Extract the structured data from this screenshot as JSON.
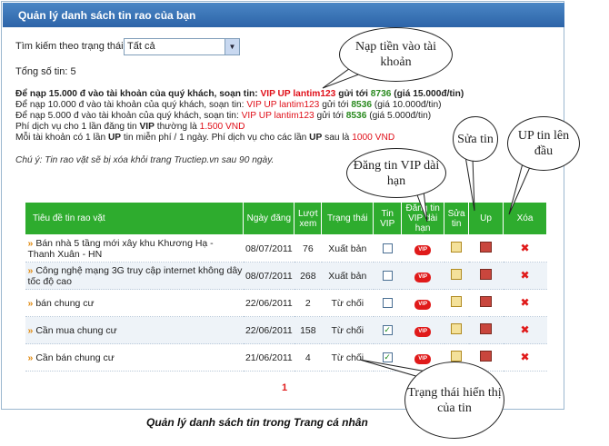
{
  "header": {
    "title": "Quản lý danh sách tin rao của bạn"
  },
  "filter": {
    "label": "Tìm kiếm theo trạng thái:",
    "selected": "Tất cả"
  },
  "total": "Tổng số tin: 5",
  "info": {
    "line1": {
      "a": "Để nạp 15.000 đ vào tài khoản của quý khách, soạn tin: ",
      "code": "VIP UP lantim123",
      "b": " gửi tới ",
      "num": "8736",
      "c": " (giá 15.000đ/tin)"
    },
    "line2": {
      "a": "Để nạp 10.000 đ vào tài khoản của quý khách, soạn tin: ",
      "code": "VIP UP lantim123",
      "b": " gửi tới ",
      "num": "8536",
      "c": " (giá 10.000đ/tin)"
    },
    "line3": {
      "a": "Để nạp 5.000 đ vào tài khoản của quý khách, soạn tin: ",
      "code": "VIP UP lantim123",
      "b": " gửi tới ",
      "num": "8536",
      "c": " (giá 5.000đ/tin)"
    },
    "line4": {
      "a": "Phí dịch vụ cho 1 lần đăng tin ",
      "vip": "VIP",
      "b": " thường là ",
      "price": "1.500 VND"
    },
    "line5": {
      "a": "Mỗi tài khoản có 1 lần ",
      "up": "UP",
      "b": " tin miễn phí / 1 ngày. Phí dịch vụ cho các lần ",
      "up2": "UP",
      "c": " sau là ",
      "price": "1000 VND"
    }
  },
  "note": "Chú ý: Tin rao vặt sẽ bị xóa khỏi trang Tructiep.vn sau 90 ngày.",
  "table": {
    "headers": [
      "Tiêu   đề tin rao vặt",
      "Ngày đăng",
      "Lượt xem",
      "Trạng thái",
      "Tin VIP",
      "Đăng tin VIP dài hạn",
      "Sửa tin",
      "Up",
      "Xóa"
    ],
    "rows": [
      {
        "title": "Bán nhà 5 tầng mới xây khu Khương Hạ - Thanh Xuân - HN",
        "date": "08/07/2011",
        "views": "76",
        "status": "Xuất bản",
        "vip": false
      },
      {
        "title": "Công nghệ mạng 3G truy cập internet không dây tốc độ cao",
        "date": "08/07/2011",
        "views": "268",
        "status": "Xuất bản",
        "vip": false
      },
      {
        "title": "bán chung cư",
        "date": "22/06/2011",
        "views": "2",
        "status": "Từ chối",
        "vip": false
      },
      {
        "title": "Cần mua chung cư",
        "date": "22/06/2011",
        "views": "158",
        "status": "Từ chối",
        "vip": true
      },
      {
        "title": "Cần bán chung cư",
        "date": "21/06/2011",
        "views": "4",
        "status": "Từ chối",
        "vip": true
      }
    ]
  },
  "pager": "1",
  "vip_badge": "VIP",
  "callouts": {
    "topup": "Nạp tiền vào tài khoản",
    "edit": "Sửa tin",
    "up": "UP tin lên đầu",
    "vip_long": "Đăng tin VIP dài hạn",
    "status": "Trạng thái hiển thị của tin"
  },
  "caption": "Quản lý danh sách tin trong Trang cá nhân",
  "colors": {
    "header": "#2d64a8",
    "table_header": "#2eac2e",
    "accent_red": "#e0101a",
    "accent_green": "#2a8a1f"
  }
}
